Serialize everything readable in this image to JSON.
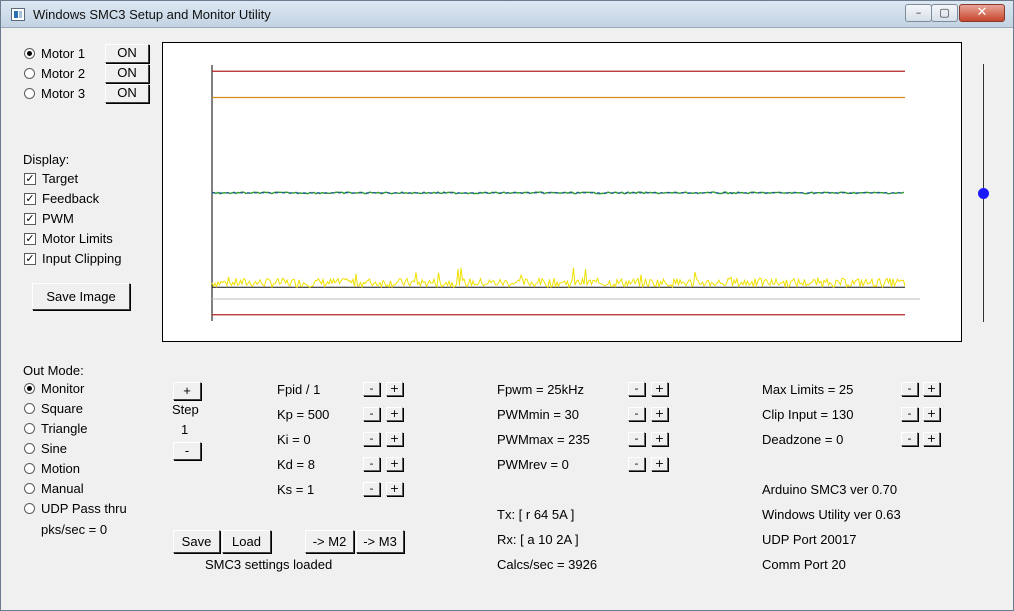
{
  "window": {
    "title": "Windows SMC3 Setup and Monitor Utility",
    "min_glyph": "–",
    "max_glyph": "▢",
    "close_glyph": "✕"
  },
  "motors": [
    {
      "label": "Motor 1",
      "button": "ON",
      "selected": true
    },
    {
      "label": "Motor 2",
      "button": "ON",
      "selected": false
    },
    {
      "label": "Motor 3",
      "button": "ON",
      "selected": false
    }
  ],
  "display": {
    "heading": "Display:",
    "items": [
      {
        "label": "Target",
        "checked": true
      },
      {
        "label": "Feedback",
        "checked": true
      },
      {
        "label": "PWM",
        "checked": true
      },
      {
        "label": "Motor Limits",
        "checked": true
      },
      {
        "label": "Input Clipping",
        "checked": true
      }
    ],
    "save_image": "Save Image"
  },
  "out_mode": {
    "heading": "Out Mode:",
    "items": [
      {
        "label": "Monitor",
        "selected": true
      },
      {
        "label": "Square",
        "selected": false
      },
      {
        "label": "Triangle",
        "selected": false
      },
      {
        "label": "Sine",
        "selected": false
      },
      {
        "label": "Motion",
        "selected": false
      },
      {
        "label": "Manual",
        "selected": false
      },
      {
        "label": "UDP Pass thru",
        "selected": false
      }
    ],
    "pks_sec": "pks/sec = 0"
  },
  "step": {
    "plus": "+",
    "label": "Step",
    "value": "1",
    "minus": "-"
  },
  "params_col1": [
    "Fpid / 1",
    "Kp = 500",
    "Ki = 0",
    "Kd = 8",
    "Ks = 1"
  ],
  "params_col2": [
    "Fpwm = 25kHz",
    "PWMmin = 30",
    "PWMmax = 235",
    "PWMrev = 0"
  ],
  "params_col3": [
    "Max Limits = 25",
    "Clip Input = 130",
    "Deadzone = 0"
  ],
  "adjust": {
    "minus": "-",
    "plus": "+"
  },
  "actions": {
    "save": "Save",
    "load": "Load",
    "to_m2": "-> M2",
    "to_m3": "-> M3"
  },
  "status": {
    "settings_msg": "SMC3 settings loaded",
    "tx": "Tx: [ r 64 5A ]",
    "rx": "Rx: [ a 10 2A ]",
    "calcs": "Calcs/sec = 3926"
  },
  "info": [
    "Arduino SMC3 ver 0.70",
    "Windows Utility ver 0.63",
    "UDP Port 20017",
    "Comm Port 20"
  ],
  "slider": {
    "level": 0.5
  },
  "chart_data": {
    "type": "line",
    "grid": false,
    "colors": {
      "limits": "#b22222",
      "clipping": "#d98c1a",
      "target": "#1f3fbf",
      "feedback": "#2a9a2a",
      "pwm": "#f0e000",
      "pwm_base": "#111111",
      "axis": "#000000"
    },
    "ylim": [
      0,
      1023
    ],
    "series": [
      {
        "key": "limits",
        "values": [
          25,
          998
        ]
      },
      {
        "key": "clipping",
        "values": [
          893
        ]
      },
      {
        "key": "target",
        "values": [
          512
        ]
      },
      {
        "key": "feedback",
        "values": [
          512
        ]
      },
      {
        "key": "pwm",
        "values": [
          135
        ]
      }
    ]
  }
}
